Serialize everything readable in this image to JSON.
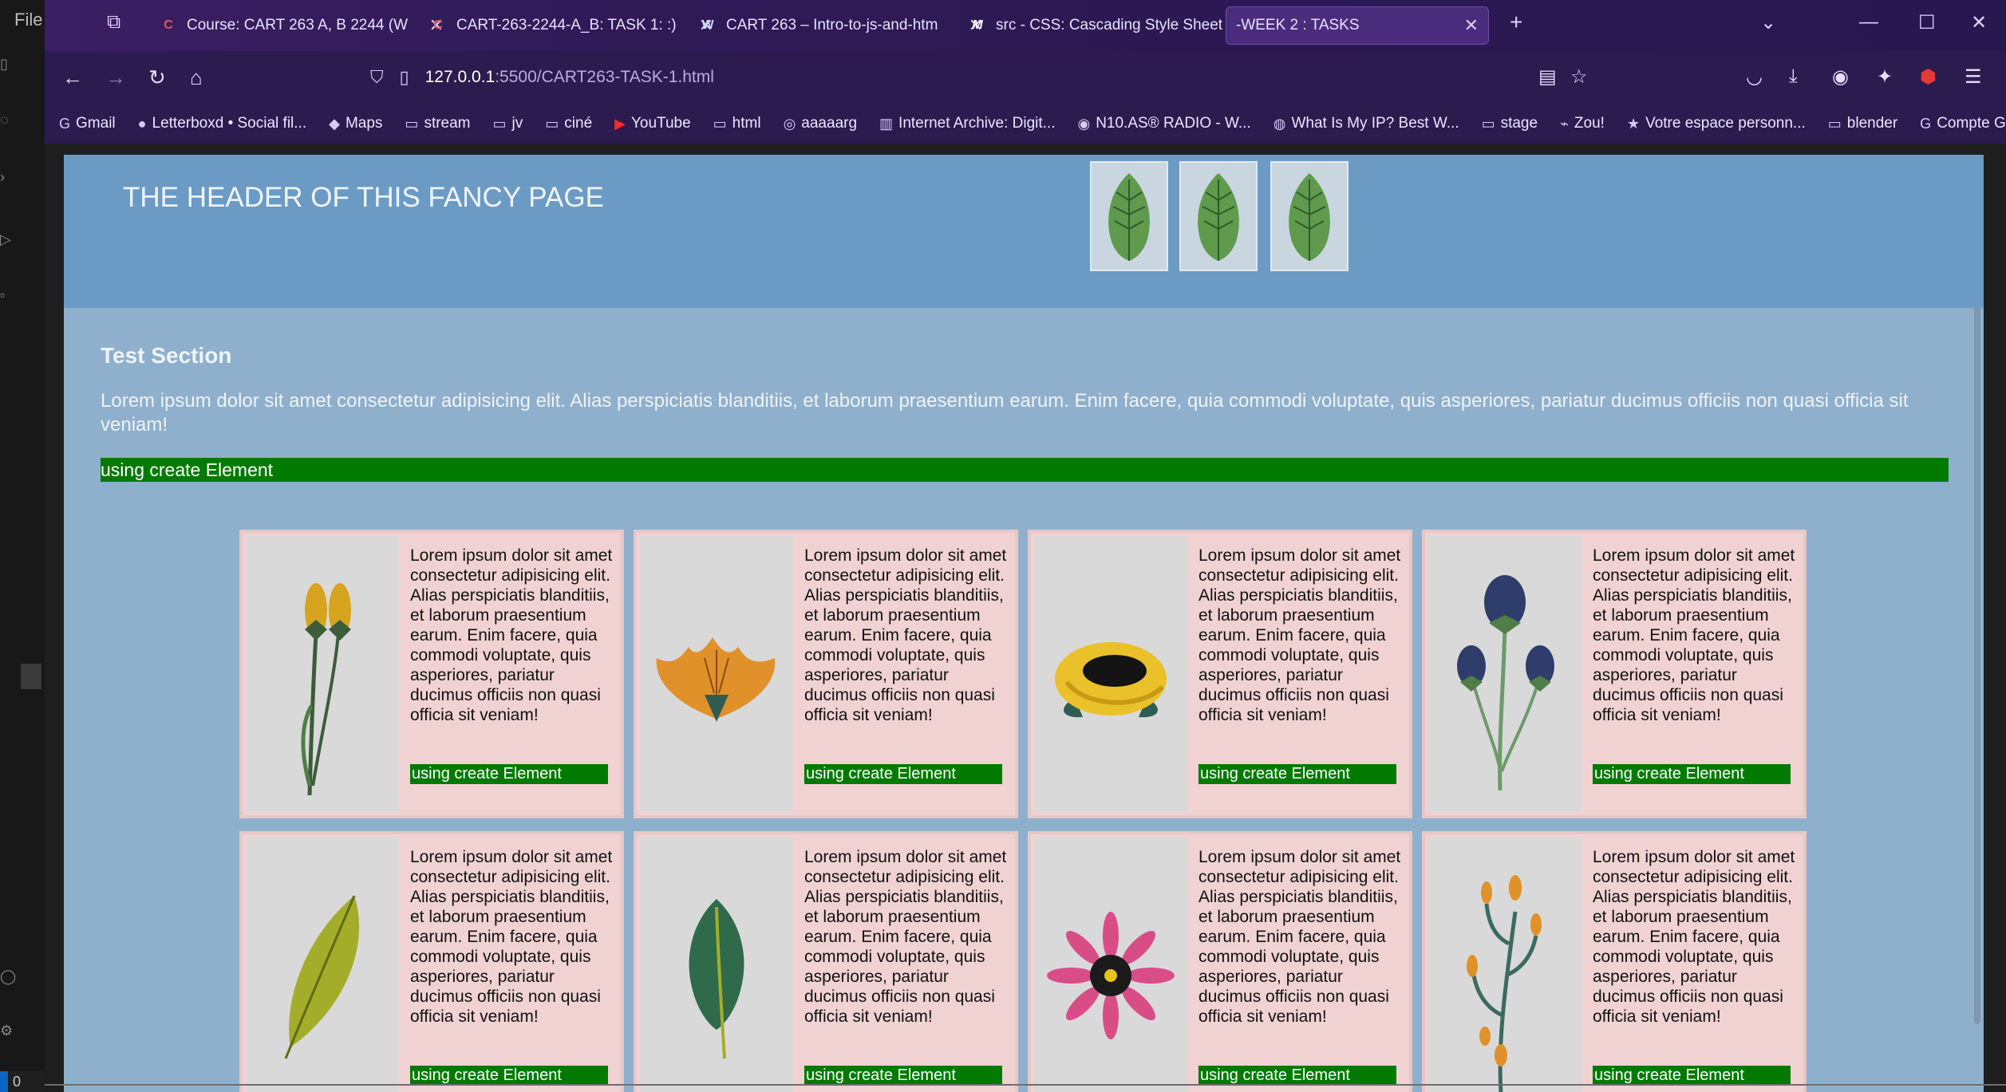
{
  "editor": {
    "file_menu": "File",
    "status_count": "0"
  },
  "browser": {
    "tabs": [
      {
        "label": "Course: CART 263 A, B 2244 (W",
        "favicon": "C"
      },
      {
        "label": "CART-263-2244-A_B: TASK 1: :)",
        "favicon": "C"
      },
      {
        "label": "CART 263 – Intro-to-js-and-htm",
        "favicon": "W"
      },
      {
        "label": "src - CSS: Cascading Style Sheet",
        "favicon": "M"
      },
      {
        "label": "-WEEK 2 : TASKS",
        "favicon": ""
      }
    ],
    "new_tab_icon": "+",
    "url": {
      "host": "127.0.0.1",
      "rest": ":5500/CART263-TASK-1.html"
    },
    "bookmarks": [
      {
        "label": "Gmail",
        "icon": "G"
      },
      {
        "label": "Letterboxd • Social fil...",
        "icon": "●"
      },
      {
        "label": "Maps",
        "icon": "◆"
      },
      {
        "label": "stream",
        "icon": "▭"
      },
      {
        "label": "jv",
        "icon": "▭"
      },
      {
        "label": "ciné",
        "icon": "▭"
      },
      {
        "label": "YouTube",
        "icon": "▶"
      },
      {
        "label": "html",
        "icon": "▭"
      },
      {
        "label": "aaaaarg",
        "icon": "◎"
      },
      {
        "label": "Internet Archive: Digit...",
        "icon": "▥"
      },
      {
        "label": "N10.AS® RADIO - W...",
        "icon": "◉"
      },
      {
        "label": "What Is My IP? Best W...",
        "icon": "◍"
      },
      {
        "label": "stage",
        "icon": "▭"
      },
      {
        "label": "Zou!",
        "icon": "⌁"
      },
      {
        "label": "Votre espace personn...",
        "icon": "★"
      },
      {
        "label": "blender",
        "icon": "▭"
      },
      {
        "label": "Compte Google",
        "icon": "G"
      }
    ],
    "overflow_icon": "»"
  },
  "page": {
    "header_title": "THE HEADER OF THIS FANCY PAGE",
    "section_title": "Test Section",
    "section_text": "Lorem ipsum dolor sit amet consectetur adipisicing elit. Alias perspiciatis blanditiis, et laborum praesentium earum. Enim facere, quia commodi voluptate, quis asperiores, pariatur ducimus officiis non quasi officia sit veniam!",
    "section_bar": "using create Element",
    "card_text": "Lorem ipsum dolor sit amet consectetur adipisicing elit. Alias perspiciatis blanditiis, et laborum praesentium earum. Enim facere, quia commodi voluptate, quis asperiores, pariatur ducimus officiis non quasi officia sit veniam!",
    "card_bar": "using create Element",
    "cards": [
      {
        "image": "yellow-tulip-stems"
      },
      {
        "image": "orange-flower"
      },
      {
        "image": "yellow-rose"
      },
      {
        "image": "blue-thistle-flowers"
      },
      {
        "image": "green-leaf"
      },
      {
        "image": "dark-green-leaf"
      },
      {
        "image": "pink-daisy"
      },
      {
        "image": "orange-berry-branch"
      }
    ]
  },
  "colors": {
    "header_bg": "#6b9bc5",
    "page_bg": "#8fb0cc",
    "bar_green": "#007a00",
    "card_bg": "#f0d2d2"
  }
}
